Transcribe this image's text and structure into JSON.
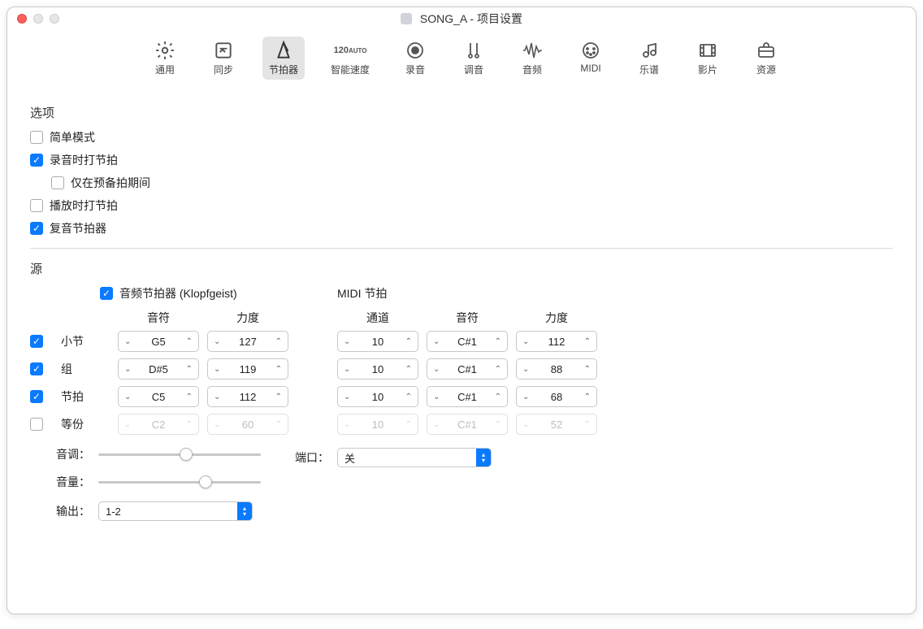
{
  "window": {
    "title": "SONG_A - 项目设置"
  },
  "toolbar": {
    "items": [
      {
        "label": "通用",
        "icon": "gear"
      },
      {
        "label": "同步",
        "icon": "sync"
      },
      {
        "label": "节拍器",
        "icon": "metronome",
        "active": true
      },
      {
        "label": "智能速度",
        "icon": "auto120"
      },
      {
        "label": "录音",
        "icon": "record"
      },
      {
        "label": "调音",
        "icon": "tuner"
      },
      {
        "label": "音频",
        "icon": "audio"
      },
      {
        "label": "MIDI",
        "icon": "midi"
      },
      {
        "label": "乐谱",
        "icon": "score"
      },
      {
        "label": "影片",
        "icon": "film"
      },
      {
        "label": "资源",
        "icon": "assets"
      }
    ]
  },
  "options": {
    "header": "选项",
    "simpleMode": {
      "label": "简单模式",
      "checked": false
    },
    "clickWhileRecording": {
      "label": "录音时打节拍",
      "checked": true
    },
    "onlyDuringCountIn": {
      "label": "仅在预备拍期间",
      "checked": false
    },
    "clickWhilePlaying": {
      "label": "播放时打节拍",
      "checked": false
    },
    "polyphonic": {
      "label": "复音节拍器",
      "checked": true
    }
  },
  "source": {
    "header": "源",
    "audioClick": {
      "label": "音频节拍器 (Klopfgeist)",
      "checked": true
    },
    "midiClick": {
      "label": "MIDI 节拍"
    },
    "columns": {
      "note": "音符",
      "velocity": "力度",
      "channel": "通道"
    },
    "rows": {
      "bar": {
        "label": "小节",
        "checked": true,
        "note": "G5",
        "vel": "127",
        "mChan": "10",
        "mNote": "C#1",
        "mVel": "112"
      },
      "group": {
        "label": "组",
        "checked": true,
        "note": "D#5",
        "vel": "119",
        "mChan": "10",
        "mNote": "C#1",
        "mVel": "88"
      },
      "beat": {
        "label": "节拍",
        "checked": true,
        "note": "C5",
        "vel": "112",
        "mChan": "10",
        "mNote": "C#1",
        "mVel": "68"
      },
      "div": {
        "label": "等份",
        "checked": false,
        "note": "C2",
        "vel": "60",
        "mChan": "10",
        "mNote": "C#1",
        "mVel": "52"
      }
    },
    "pitch": {
      "label": "音调：",
      "value": 50
    },
    "volume": {
      "label": "音量：",
      "value": 62
    },
    "output": {
      "label": "输出：",
      "value": "1-2"
    },
    "port": {
      "label": "端口：",
      "value": "关"
    }
  }
}
